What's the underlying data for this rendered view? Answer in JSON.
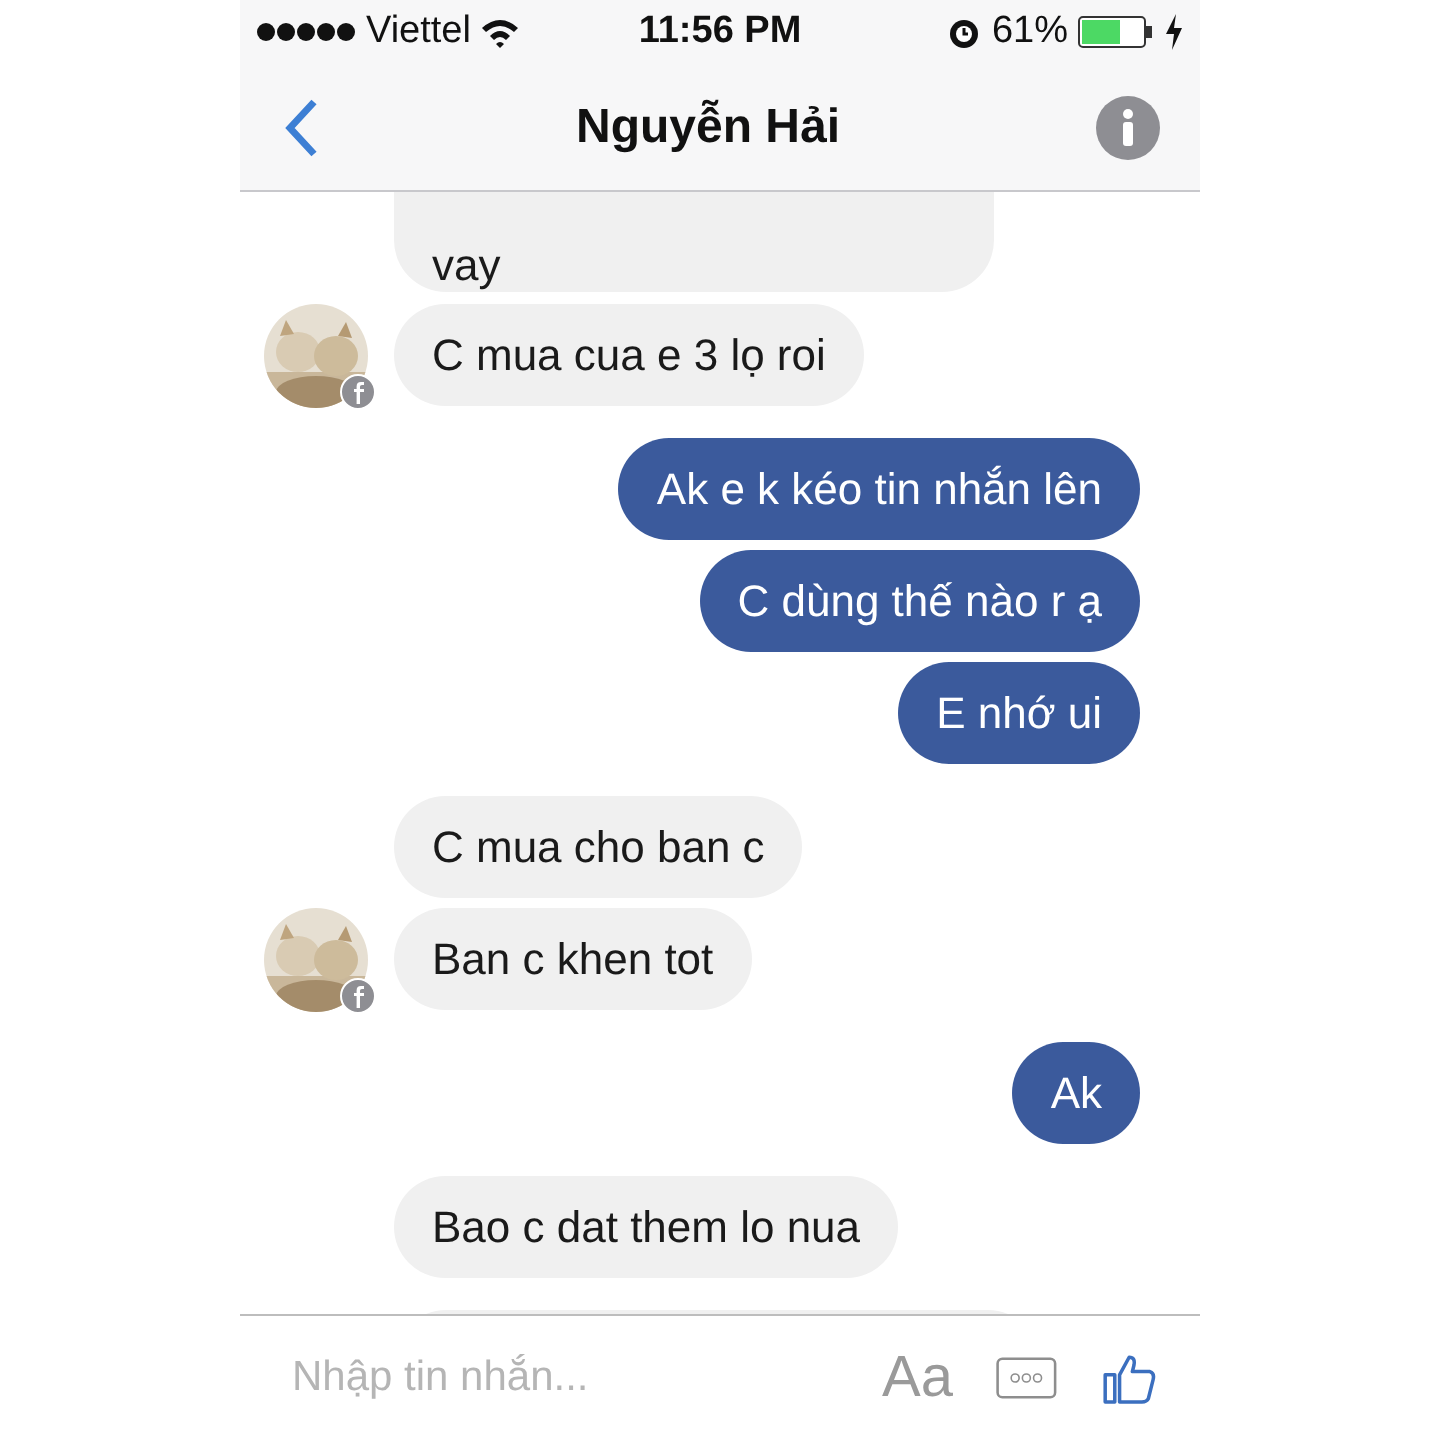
{
  "status_bar": {
    "carrier": "Viettel",
    "time": "11:56 PM",
    "battery": "61%"
  },
  "header": {
    "title": "Nguyễn Hải"
  },
  "messages": [
    {
      "kind": "cut_top",
      "outgoing": false,
      "text": "vay",
      "avatar": false
    },
    {
      "kind": "full",
      "outgoing": false,
      "text": "C mua cua e 3 lọ roi",
      "avatar": true
    },
    {
      "kind": "full",
      "outgoing": true,
      "text": "Ak e k kéo tin nhắn lên",
      "avatar": false
    },
    {
      "kind": "full",
      "outgoing": true,
      "text": "C dùng thế nào r ạ",
      "avatar": false
    },
    {
      "kind": "full",
      "outgoing": true,
      "text": "E nhớ ui",
      "avatar": false
    },
    {
      "kind": "full",
      "outgoing": false,
      "text": "C mua cho ban c",
      "avatar": false
    },
    {
      "kind": "full",
      "outgoing": false,
      "text": "Ban c khen tot",
      "avatar": true
    },
    {
      "kind": "full",
      "outgoing": true,
      "text": "Ak",
      "avatar": false
    },
    {
      "kind": "full",
      "outgoing": false,
      "text": "Bao c dat them lo nua",
      "avatar": false
    },
    {
      "kind": "cut_bottom",
      "outgoing": false,
      "avatar": false
    }
  ],
  "composer": {
    "placeholder": "Nhập tin nhắn...",
    "font_button": "Aa"
  }
}
